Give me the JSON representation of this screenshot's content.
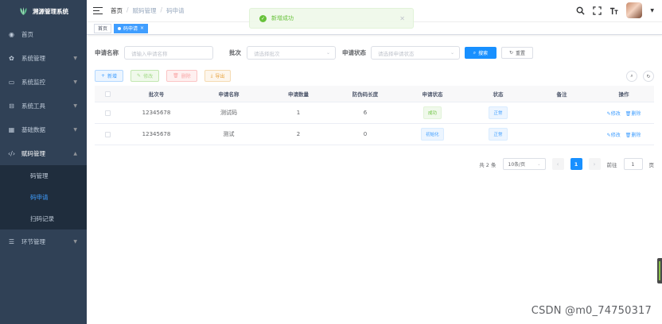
{
  "app": {
    "title": "溯源管理系统"
  },
  "sidebar": {
    "items": [
      {
        "label": "首页",
        "icon": "dashboard-icon"
      },
      {
        "label": "系统管理",
        "icon": "gear-icon"
      },
      {
        "label": "系统监控",
        "icon": "monitor-icon"
      },
      {
        "label": "系统工具",
        "icon": "toolbox-icon"
      },
      {
        "label": "基础数据",
        "icon": "grid-icon"
      },
      {
        "label": "赋码管理",
        "icon": "code-icon"
      }
    ],
    "submenu": [
      "码管理",
      "码申请",
      "扫码记录"
    ],
    "after": {
      "label": "环节管理",
      "icon": "list-icon"
    }
  },
  "breadcrumb": [
    "首页",
    "赋码管理",
    "码申请"
  ],
  "toast": {
    "message": "新增成功",
    "type": "success",
    "color": "#67c23a"
  },
  "tags": [
    "首页",
    "码申请"
  ],
  "search": {
    "name_label": "申请名称",
    "name_placeholder": "请输入申请名称",
    "batch_label": "批次",
    "batch_placeholder": "请选择批次",
    "status_label": "申请状态",
    "status_placeholder": "请选择申请状态",
    "search_button": "搜索",
    "reset_button": "重置"
  },
  "toolbar": {
    "add": "新增",
    "edit": "修改",
    "delete": "删除",
    "export": "导出"
  },
  "table": {
    "headers": [
      "批次号",
      "申请名称",
      "申请数量",
      "防伪码长度",
      "申请状态",
      "状态",
      "备注",
      "操作"
    ],
    "rows": [
      {
        "batch": "12345678",
        "name": "测试码",
        "qty": "1",
        "length": "6",
        "apply_status": "成功",
        "status": "正常",
        "remark": "",
        "edit": "修改",
        "delete": "删除"
      },
      {
        "batch": "12345678",
        "name": "测试",
        "qty": "2",
        "length": "0",
        "apply_status": "初始化",
        "status": "正常",
        "remark": "",
        "edit": "修改",
        "delete": "删除"
      }
    ]
  },
  "pagination": {
    "total": "共 2 条",
    "page_size": "10条/页",
    "current": "1",
    "goto_label": "前往",
    "goto_value": "1",
    "goto_suffix": "页"
  },
  "colors": {
    "primary": "#1890ff",
    "sidebar_bg": "#304156",
    "success": "#67c23a"
  },
  "watermark": "CSDN @m0_74750317"
}
